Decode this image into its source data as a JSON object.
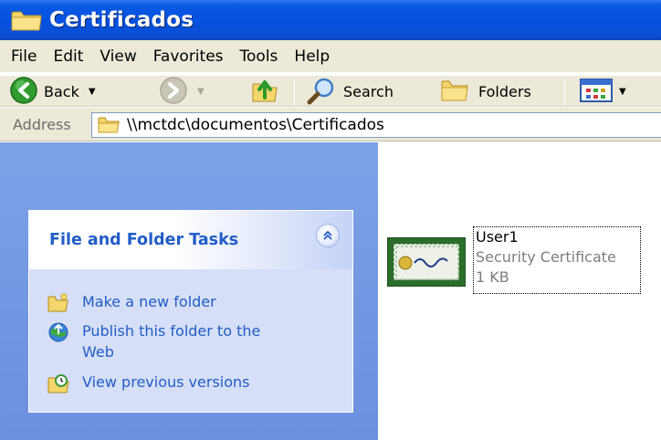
{
  "window": {
    "title": "Certificados"
  },
  "menu": [
    "File",
    "Edit",
    "View",
    "Favorites",
    "Tools",
    "Help"
  ],
  "toolbar": {
    "back_label": "Back",
    "search_label": "Search",
    "folders_label": "Folders"
  },
  "address": {
    "label": "Address",
    "path": "\\\\mctdc\\documentos\\Certificados"
  },
  "tasks": {
    "title": "File and Folder Tasks",
    "items": [
      {
        "label": "Make a new folder",
        "icon": "new-folder-icon"
      },
      {
        "label": "Publish this folder to the Web",
        "icon": "publish-web-icon"
      },
      {
        "label": "View previous versions",
        "icon": "previous-versions-icon"
      }
    ]
  },
  "files": [
    {
      "name": "User1",
      "type": "Security Certificate",
      "size": "1 KB",
      "icon": "certificate-icon"
    }
  ],
  "colors": {
    "titlebar": "#0551e0",
    "taskpane": "#6c8fdf",
    "task_link": "#215dc6"
  }
}
